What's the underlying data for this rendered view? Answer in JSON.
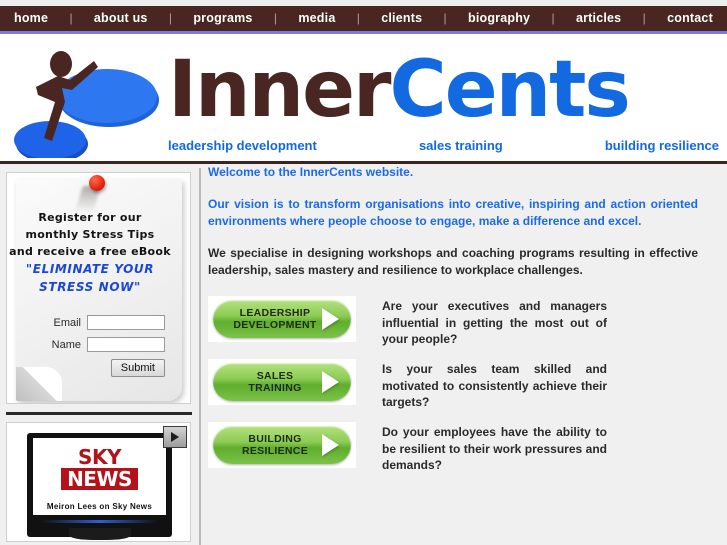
{
  "nav": {
    "separator": "|",
    "items": [
      {
        "label": "home"
      },
      {
        "label": "about us"
      },
      {
        "label": "programs"
      },
      {
        "label": "media"
      },
      {
        "label": "clients"
      },
      {
        "label": "biography"
      },
      {
        "label": "articles"
      },
      {
        "label": "contact"
      }
    ]
  },
  "header": {
    "logo_word_1": "Inner",
    "logo_word_2": "Cents",
    "taglines": [
      "leadership development",
      "sales training",
      "building resilience"
    ],
    "colors": {
      "brown": "#4a2623",
      "blue": "#1269e0",
      "nav_underline": "#7b7bda"
    }
  },
  "sidebar": {
    "signup": {
      "line1": "Register for our",
      "line2": "monthly Stress Tips",
      "line3": "and receive a free eBook",
      "quote_line1": "\"ELIMINATE YOUR",
      "quote_line2": "STRESS NOW\"",
      "email_label": "Email",
      "email_value": "",
      "email_placeholder": "",
      "name_label": "Name",
      "name_value": "",
      "name_placeholder": "",
      "submit_label": "Submit"
    },
    "video": {
      "brand_top": "SKY",
      "brand_bottom": "NEWS",
      "caption": "Meiron Lees on Sky News",
      "play_icon": "play-icon"
    }
  },
  "main": {
    "paragraphs": [
      {
        "text": "Welcome to the InnerCents website.",
        "style": "blue"
      },
      {
        "text": "Our vision is to transform organisations into creative, inspiring and action oriented environments where people choose to engage, make a difference and excel.",
        "style": "blue"
      },
      {
        "text": "We specialise in designing workshops and coaching programs resulting in effective leadership, sales mastery and resilience to workplace challenges.",
        "style": "dark"
      }
    ],
    "cta_items": [
      {
        "label_line1": "LEADERSHIP",
        "label_line2": "DEVELOPMENT",
        "text": "Are your executives and managers influential in getting the most out of your people?"
      },
      {
        "label_line1": "SALES",
        "label_line2": "TRAINING",
        "text": "Is your sales team skilled and motivated to consistently achieve their targets?"
      },
      {
        "label_line1": "BUILDING",
        "label_line2": "RESILIENCE",
        "text": "Do your employees have the ability to be resilient to their work pressures and demands?"
      }
    ]
  }
}
